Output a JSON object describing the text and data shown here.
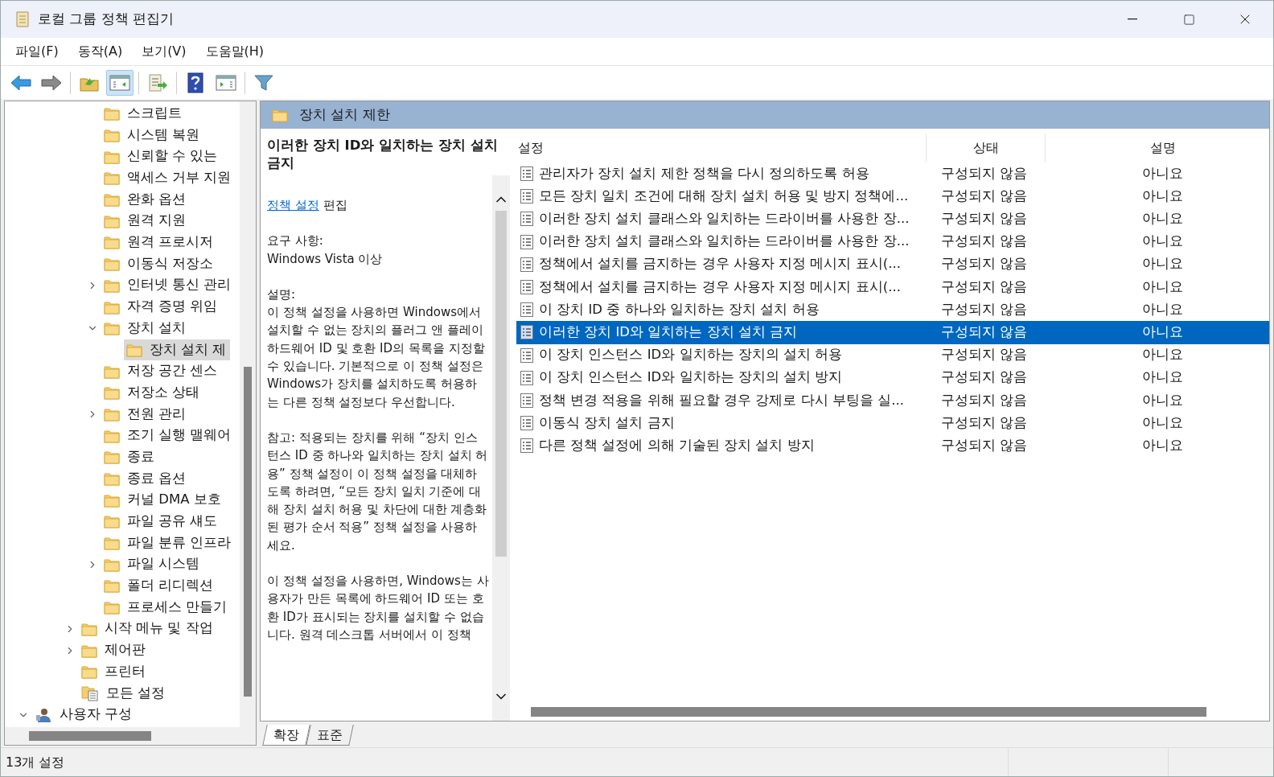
{
  "window": {
    "title": "로컬 그룹 정책 편집기"
  },
  "menu": [
    "파일(F)",
    "동작(A)",
    "보기(V)",
    "도움말(H)"
  ],
  "toolbar": [
    [
      {
        "kind": "back",
        "pressed": false
      },
      {
        "kind": "forward",
        "pressed": false
      }
    ],
    [
      {
        "kind": "up",
        "pressed": false
      },
      {
        "kind": "tree",
        "pressed": true
      }
    ],
    [
      {
        "kind": "export",
        "pressed": false
      }
    ],
    [
      {
        "kind": "help",
        "pressed": false
      },
      {
        "kind": "pane",
        "pressed": false
      }
    ],
    [
      {
        "kind": "filter",
        "pressed": false
      }
    ]
  ],
  "tree": {
    "inner_items": [
      {
        "label": "스크립트",
        "selected": false
      },
      {
        "label": "시스템 복원",
        "selected": false
      },
      {
        "label": "신뢰할 수 있는",
        "selected": false
      },
      {
        "label": "액세스 거부 지원",
        "selected": false
      },
      {
        "label": "완화 옵션",
        "selected": false
      },
      {
        "label": "원격 지원",
        "selected": false
      },
      {
        "label": "원격 프로시저",
        "selected": false
      },
      {
        "label": "이동식 저장소",
        "selected": false
      },
      {
        "label": "인터넷 통신 관리",
        "selected": false,
        "expanded": false
      },
      {
        "label": "자격 증명 위임",
        "selected": false
      },
      {
        "label": "장치 설치",
        "selected": false,
        "expanded": true,
        "children": [
          {
            "label": "장치 설치 제",
            "selected": true
          }
        ]
      },
      {
        "label": "저장 공간 센스",
        "selected": false
      },
      {
        "label": "저장소 상태",
        "selected": false
      },
      {
        "label": "전원 관리",
        "selected": false,
        "expanded": false
      },
      {
        "label": "조기 실행 맬웨어",
        "selected": false
      },
      {
        "label": "종료",
        "selected": false
      },
      {
        "label": "종료 옵션",
        "selected": false
      },
      {
        "label": "커널 DMA 보호",
        "selected": false
      },
      {
        "label": "파일 공유 섀도",
        "selected": false
      },
      {
        "label": "파일 분류 인프라",
        "selected": false
      },
      {
        "label": "파일 시스템",
        "selected": false,
        "expanded": false
      },
      {
        "label": "폴더 리디렉션",
        "selected": false
      },
      {
        "label": "프로세스 만들기",
        "selected": false
      }
    ],
    "outer_items": [
      {
        "label": "시작 메뉴 및 작업",
        "selected": false,
        "expanded": false,
        "kind": "folder"
      },
      {
        "label": "제어판",
        "selected": false,
        "expanded": false,
        "kind": "folder"
      },
      {
        "label": "프린터",
        "selected": false,
        "kind": "folder"
      },
      {
        "label": "모든 설정",
        "selected": false,
        "kind": "settings"
      }
    ],
    "root_items": [
      {
        "label": "사용자 구성",
        "selected": false,
        "expanded": true
      }
    ]
  },
  "header": {
    "title": "장치 설치 제한"
  },
  "description": {
    "title": "이러한 장치 ID와 일치하는 장치 설치 금지",
    "link": "정책 설정",
    "link_suffix": "편집",
    "requirements_label": "요구 사항:",
    "requirements": "Windows Vista 이상",
    "description_label": "설명:",
    "paragraphs": [
      "이 정책 설정을 사용하면 Windows에서 설치할 수 없는 장치의 플러그 앤 플레이 하드웨어 ID 및 호환 ID의 목록을 지정할 수 있습니다. 기본적으로 이 정책 설정은 Windows가 장치를 설치하도록 허용하는 다른 정책 설정보다 우선합니다.",
      "참고: 적용되는 장치를 위해 “장치 인스턴스 ID 중 하나와 일치하는 장치 설치 허용” 정책 설정이 이 정책 설정을 대체하도록 하려면, “모든 장치 일치 기준에 대해 장치 설치 허용 및 차단에 대한 계층화된 평가 순서 적용” 정책 설정을 사용하세요.",
      "이 정책 설정을 사용하면, Windows는 사용자가 만든 목록에 하드웨어 ID 또는 호환 ID가 표시되는 장치를 설치할 수 없습니다. 원격 데스크톱 서버에서 이 정책"
    ]
  },
  "table": {
    "columns": [
      "설정",
      "상태",
      "설명"
    ],
    "rows": [
      {
        "setting": "관리자가 장치 설치 제한 정책을 다시 정의하도록 허용",
        "state": "구성되지 않음",
        "comment": "아니요",
        "selected": false
      },
      {
        "setting": "모든 장치 일치 조건에 대해 장치 설치 허용 및 방지 정책에...",
        "state": "구성되지 않음",
        "comment": "아니요",
        "selected": false
      },
      {
        "setting": "이러한 장치 설치 클래스와 일치하는 드라이버를 사용한 장...",
        "state": "구성되지 않음",
        "comment": "아니요",
        "selected": false
      },
      {
        "setting": "이러한 장치 설치 클래스와 일치하는 드라이버를 사용한 장...",
        "state": "구성되지 않음",
        "comment": "아니요",
        "selected": false
      },
      {
        "setting": "정책에서 설치를 금지하는 경우 사용자 지정 메시지 표시(...",
        "state": "구성되지 않음",
        "comment": "아니요",
        "selected": false
      },
      {
        "setting": "정책에서 설치를 금지하는 경우 사용자 지정 메시지 표시(...",
        "state": "구성되지 않음",
        "comment": "아니요",
        "selected": false
      },
      {
        "setting": "이 장치 ID 중 하나와 일치하는 장치 설치 허용",
        "state": "구성되지 않음",
        "comment": "아니요",
        "selected": false
      },
      {
        "setting": "이러한 장치 ID와 일치하는 장치 설치 금지",
        "state": "구성되지 않음",
        "comment": "아니요",
        "selected": true
      },
      {
        "setting": "이 장치 인스턴스 ID와 일치하는 장치의 설치 허용",
        "state": "구성되지 않음",
        "comment": "아니요",
        "selected": false
      },
      {
        "setting": "이 장치 인스턴스 ID와 일치하는 장치의 설치 방지",
        "state": "구성되지 않음",
        "comment": "아니요",
        "selected": false
      },
      {
        "setting": "정책 변경 적용을 위해 필요할 경우 강제로 다시 부팅을 실...",
        "state": "구성되지 않음",
        "comment": "아니요",
        "selected": false
      },
      {
        "setting": "이동식 장치 설치 금지",
        "state": "구성되지 않음",
        "comment": "아니요",
        "selected": false
      },
      {
        "setting": "다른 정책 설정에 의해 기술된 장치 설치 방지",
        "state": "구성되지 않음",
        "comment": "아니요",
        "selected": false
      }
    ]
  },
  "view_tabs": [
    {
      "label": "확장",
      "selected": true
    },
    {
      "label": "표준",
      "selected": false
    }
  ],
  "status_bar": {
    "text": "13개 설정"
  }
}
